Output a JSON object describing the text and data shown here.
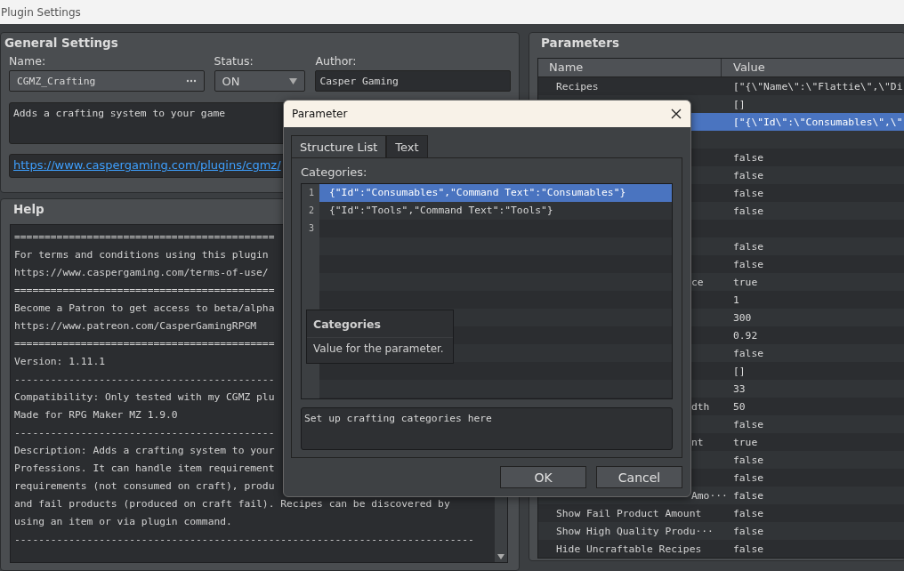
{
  "window": {
    "title": "Plugin Settings"
  },
  "general": {
    "heading": "General Settings",
    "name_label": "Name:",
    "name_value": "CGMZ_Crafting",
    "status_label": "Status:",
    "status_value": "ON",
    "author_label": "Author:",
    "author_value": "Casper Gaming",
    "description": "Adds a crafting system to your game",
    "url": "https://www.caspergaming.com/plugins/cgmz/"
  },
  "help": {
    "heading": "Help",
    "lines": [
      "===========================================",
      "For terms and conditions using this plugin",
      "https://www.caspergaming.com/terms-of-use/",
      "===========================================",
      "Become a Patron to get access to beta/alpha",
      "https://www.patreon.com/CasperGamingRPGM",
      "===========================================",
      "Version: 1.11.1",
      "-------------------------------------------",
      "Compatibility: Only tested with my CGMZ plu",
      "Made for RPG Maker MZ 1.9.0",
      "-------------------------------------------",
      "Description: Adds a crafting system to your",
      "Professions. It can handle item requirement",
      "requirements (not consumed on craft), produ",
      "and fail products (produced on craft fail). Recipes can be discovered by",
      "using an item or via plugin command.",
      "----------------------------------------------------------------------------"
    ]
  },
  "parameters": {
    "heading": "Parameters",
    "columns": [
      "Name",
      "Value"
    ],
    "rows": [
      {
        "name": "Recipes",
        "value": "[\"{\\\"Name\\\":\\\"Flattie\\\",\\\"Di",
        "selected": false
      },
      {
        "value": "[]",
        "selected": false
      },
      {
        "value": "[\"{\\\"Id\\\":\\\"Consumables\\\",\\\"",
        "selected": true
      },
      {
        "selected": false
      },
      {
        "value": "false",
        "selected": false
      },
      {
        "value": "false",
        "selected": false
      },
      {
        "value": "false",
        "selected": false
      },
      {
        "value": "false",
        "selected": false
      },
      {
        "selected": false
      },
      {
        "value": "false",
        "selected": false
      },
      {
        "value": "false",
        "selected": false
      },
      {
        "name_end": "ce",
        "value": "true",
        "selected": false
      },
      {
        "value": "1",
        "selected": false
      },
      {
        "value": "300",
        "selected": false
      },
      {
        "value": "0.92",
        "selected": false
      },
      {
        "value": "false",
        "selected": false
      },
      {
        "value": "[]",
        "selected": false
      },
      {
        "value": "33",
        "selected": false
      },
      {
        "name_end": "dth",
        "value": "50",
        "selected": false
      },
      {
        "value": "false",
        "selected": false
      },
      {
        "name_end": "nt",
        "value": "true",
        "selected": false
      },
      {
        "value": "false",
        "selected": false
      },
      {
        "value": "false",
        "selected": false
      },
      {
        "name_end": "Amo···",
        "value": "false",
        "selected": false
      },
      {
        "name": "Show Fail Product Amount",
        "value": "false",
        "selected": false
      },
      {
        "name": "Show High Quality Produ···",
        "value": "false",
        "selected": false
      },
      {
        "name": "Hide Uncraftable Recipes",
        "value": "false",
        "selected": false
      }
    ]
  },
  "dialog": {
    "title": "Parameter",
    "tabs": [
      {
        "label": "Structure List",
        "selected": true
      },
      {
        "label": "Text",
        "selected": false
      }
    ],
    "field_label": "Categories:",
    "items": [
      {
        "number": "1",
        "text": "{\"Id\":\"Consumables\",\"Command Text\":\"Consumables\"}",
        "selected": true
      },
      {
        "number": "2",
        "text": "{\"Id\":\"Tools\",\"Command Text\":\"Tools\"}",
        "selected": false
      },
      {
        "number": "3",
        "selected": false
      }
    ],
    "tooltip": {
      "title": "Categories",
      "text": "Value for the parameter."
    },
    "description": "Set up crafting categories here",
    "buttons": [
      "OK",
      "Cancel"
    ]
  }
}
